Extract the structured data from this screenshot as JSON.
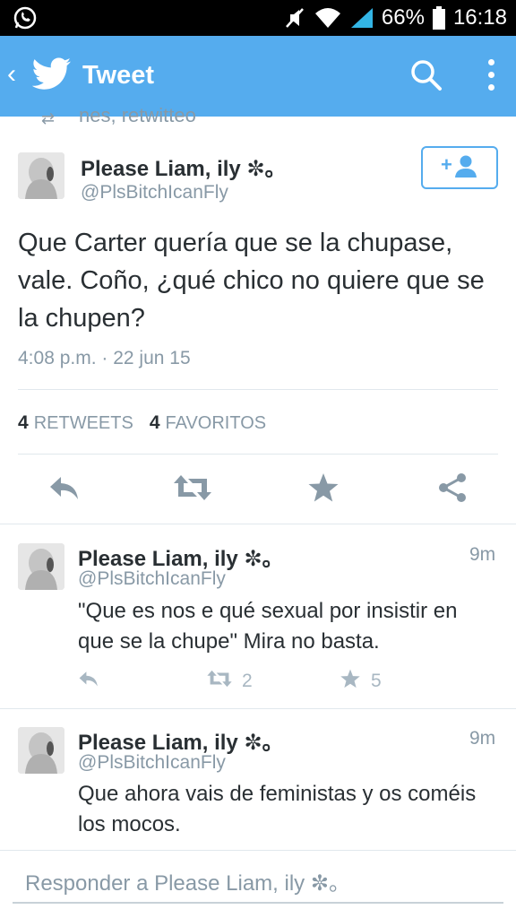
{
  "status_bar": {
    "battery": "66%",
    "time": "16:18",
    "icons": [
      "whatsapp-icon",
      "mute-icon",
      "wifi-icon",
      "signal-icon",
      "battery-icon"
    ]
  },
  "app_bar": {
    "title": "Tweet",
    "icons": [
      "back-icon",
      "twitter-bird-icon",
      "search-icon",
      "more-icon"
    ]
  },
  "header_cutoff": "nes, retwitteo",
  "main_tweet": {
    "name": "Please Liam, ily ✼。",
    "handle": "@PlsBitchIcanFly",
    "text": "Que Carter quería que se la chupase, vale. Coño, ¿qué chico no quiere que se la chupen?",
    "timestamp": "4:08 p.m. · 22 jun 15",
    "retweets_count": "4",
    "retweets_label": "RETWEETS",
    "favorites_count": "4",
    "favorites_label": "FAVORITOS"
  },
  "replies": [
    {
      "name": "Please Liam, ily ✼。",
      "handle": "@PlsBitchIcanFly",
      "time": "9m",
      "text": "\"Que es nos e qué sexual por insistir en que se la chupe\" Mira no basta.",
      "retweets": "2",
      "favorites": "5"
    },
    {
      "name": "Please Liam, ily ✼。",
      "handle": "@PlsBitchIcanFly",
      "time": "9m",
      "text": "Que ahora vais de feministas y os coméis los mocos."
    }
  ],
  "reply_input": {
    "placeholder": "Responder a Please Liam, ily ✼。"
  },
  "colors": {
    "brand": "#55acee",
    "muted": "#8899a6",
    "icon_gray": "#a8b7c2",
    "text": "#292f33"
  }
}
